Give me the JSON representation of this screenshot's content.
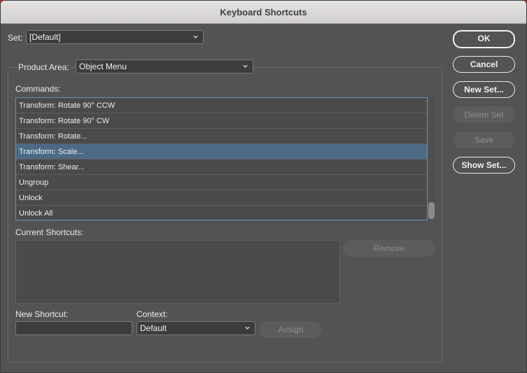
{
  "window": {
    "title": "Keyboard Shortcuts"
  },
  "set": {
    "label": "Set:",
    "value": "[Default]"
  },
  "product_area": {
    "label": "Product Area:",
    "value": "Object Menu"
  },
  "commands": {
    "label": "Commands:",
    "items": [
      {
        "label": "Transform: Rotate 90° CCW",
        "selected": false
      },
      {
        "label": "Transform: Rotate 90° CW",
        "selected": false
      },
      {
        "label": "Transform: Rotate...",
        "selected": false
      },
      {
        "label": "Transform: Scale...",
        "selected": true
      },
      {
        "label": "Transform: Shear...",
        "selected": false
      },
      {
        "label": "Ungroup",
        "selected": false
      },
      {
        "label": "Unlock",
        "selected": false
      },
      {
        "label": "Unlock All",
        "selected": false
      }
    ]
  },
  "current_shortcuts": {
    "label": "Current Shortcuts:",
    "remove_label": "Remove"
  },
  "new_shortcut": {
    "label": "New Shortcut:",
    "value": ""
  },
  "context": {
    "label": "Context:",
    "value": "Default"
  },
  "assign_label": "Assign",
  "buttons": {
    "ok": "OK",
    "cancel": "Cancel",
    "new_set": "New Set...",
    "delete_set": "Delete Set",
    "save": "Save",
    "show_set": "Show Set..."
  },
  "colors": {
    "panel_bg": "#535353",
    "selection": "#4c6a86",
    "list_focus_border": "#6f8fb0",
    "background_accent": "#b8312b"
  },
  "icons": {
    "dropdown": "chevron-down-icon"
  }
}
